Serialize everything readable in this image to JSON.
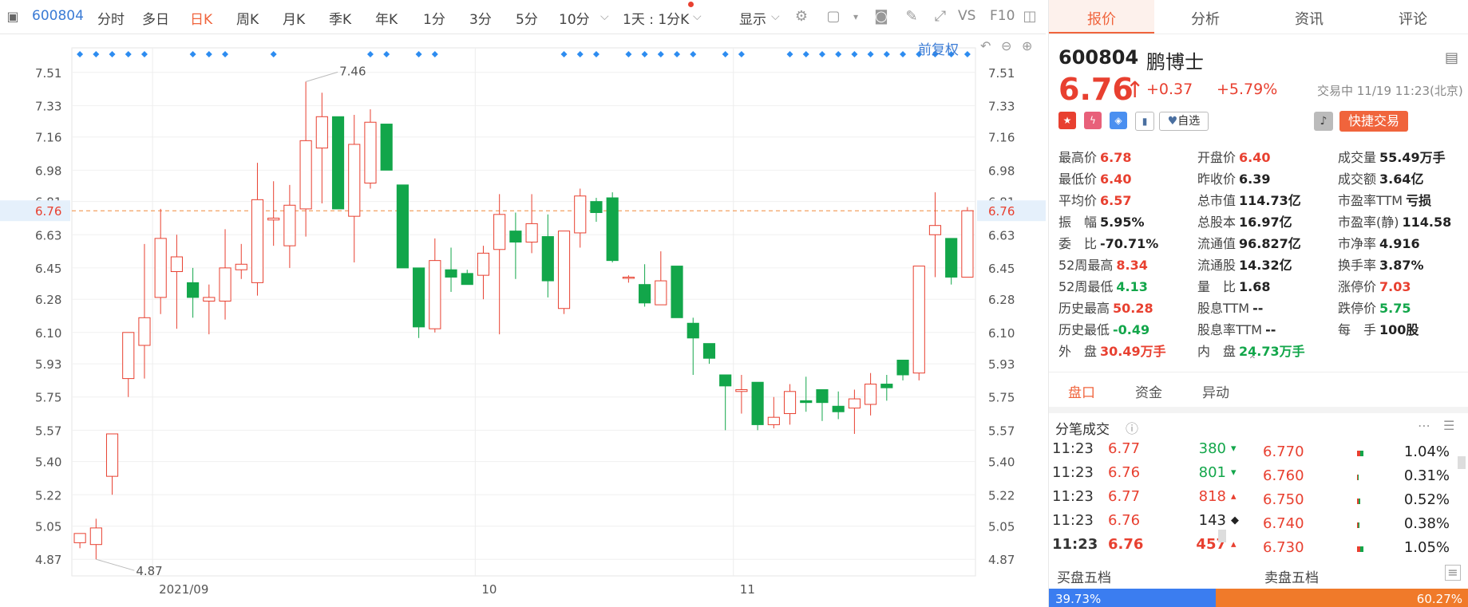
{
  "toolbar": {
    "code": "600804",
    "periods": [
      "分时",
      "多日",
      "日K",
      "周K",
      "月K",
      "季K",
      "年K",
      "1分",
      "3分",
      "5分",
      "10分"
    ],
    "active_period": "日K",
    "interval": "1天 : 1分K",
    "display": "显示",
    "vs": "VS",
    "f10": "F10",
    "adjust": "前复权"
  },
  "chart_data": {
    "type": "candlestick",
    "y_ticks": [
      7.51,
      7.33,
      7.16,
      6.98,
      6.81,
      6.63,
      6.45,
      6.28,
      6.1,
      5.93,
      5.75,
      5.57,
      5.4,
      5.22,
      5.05,
      4.87
    ],
    "ylim": [
      4.78,
      7.6
    ],
    "current_price": 6.76,
    "x_labels": [
      {
        "label": "2021/09",
        "index": 5
      },
      {
        "label": "10",
        "index": 25
      },
      {
        "label": "11",
        "index": 41
      }
    ],
    "high_annotation": {
      "label": "7.46",
      "index": 14
    },
    "low_annotation": {
      "label": "4.87",
      "index": 1
    },
    "candles": [
      {
        "o": 4.96,
        "h": 5.0,
        "l": 4.93,
        "c": 5.01
      },
      {
        "o": 4.95,
        "h": 5.09,
        "l": 4.87,
        "c": 5.04
      },
      {
        "o": 5.32,
        "h": 5.55,
        "l": 5.22,
        "c": 5.55
      },
      {
        "o": 5.85,
        "h": 6.1,
        "l": 5.75,
        "c": 6.1
      },
      {
        "o": 6.03,
        "h": 6.58,
        "l": 5.85,
        "c": 6.18
      },
      {
        "o": 6.29,
        "h": 6.77,
        "l": 6.2,
        "c": 6.61
      },
      {
        "o": 6.43,
        "h": 6.63,
        "l": 6.12,
        "c": 6.51
      },
      {
        "o": 6.37,
        "h": 6.45,
        "l": 6.18,
        "c": 6.29
      },
      {
        "o": 6.27,
        "h": 6.36,
        "l": 6.09,
        "c": 6.29
      },
      {
        "o": 6.27,
        "h": 6.66,
        "l": 6.17,
        "c": 6.45
      },
      {
        "o": 6.44,
        "h": 6.58,
        "l": 6.39,
        "c": 6.47
      },
      {
        "o": 6.37,
        "h": 7.02,
        "l": 6.3,
        "c": 6.82
      },
      {
        "o": 6.71,
        "h": 6.92,
        "l": 6.57,
        "c": 6.72
      },
      {
        "o": 6.57,
        "h": 6.9,
        "l": 6.45,
        "c": 6.79
      },
      {
        "o": 6.77,
        "h": 7.46,
        "l": 6.62,
        "c": 7.14
      },
      {
        "o": 7.1,
        "h": 7.4,
        "l": 6.8,
        "c": 7.27
      },
      {
        "o": 7.27,
        "h": 7.25,
        "l": 6.77,
        "c": 6.77
      },
      {
        "o": 6.73,
        "h": 7.28,
        "l": 6.48,
        "c": 7.12
      },
      {
        "o": 6.91,
        "h": 7.31,
        "l": 6.88,
        "c": 7.24
      },
      {
        "o": 7.23,
        "h": 7.23,
        "l": 6.98,
        "c": 6.98
      },
      {
        "o": 6.9,
        "h": 6.9,
        "l": 6.45,
        "c": 6.45
      },
      {
        "o": 6.45,
        "h": 6.45,
        "l": 6.07,
        "c": 6.13
      },
      {
        "o": 6.12,
        "h": 6.61,
        "l": 6.1,
        "c": 6.49
      },
      {
        "o": 6.44,
        "h": 6.56,
        "l": 6.32,
        "c": 6.4
      },
      {
        "o": 6.42,
        "h": 6.44,
        "l": 6.36,
        "c": 6.36
      },
      {
        "o": 6.41,
        "h": 6.57,
        "l": 6.28,
        "c": 6.53
      },
      {
        "o": 6.55,
        "h": 6.85,
        "l": 6.09,
        "c": 6.74
      },
      {
        "o": 6.65,
        "h": 6.75,
        "l": 6.39,
        "c": 6.59
      },
      {
        "o": 6.59,
        "h": 6.85,
        "l": 6.53,
        "c": 6.69
      },
      {
        "o": 6.62,
        "h": 6.74,
        "l": 6.29,
        "c": 6.38
      },
      {
        "o": 6.23,
        "h": 6.65,
        "l": 6.2,
        "c": 6.65
      },
      {
        "o": 6.64,
        "h": 6.88,
        "l": 6.56,
        "c": 6.84
      },
      {
        "o": 6.81,
        "h": 6.83,
        "l": 6.7,
        "c": 6.75
      },
      {
        "o": 6.83,
        "h": 6.86,
        "l": 6.48,
        "c": 6.49
      },
      {
        "o": 6.4,
        "h": 6.41,
        "l": 6.37,
        "c": 6.4
      },
      {
        "o": 6.36,
        "h": 6.47,
        "l": 6.24,
        "c": 6.26
      },
      {
        "o": 6.25,
        "h": 6.54,
        "l": 6.25,
        "c": 6.38
      },
      {
        "o": 6.46,
        "h": 6.46,
        "l": 6.18,
        "c": 6.18
      },
      {
        "o": 6.15,
        "h": 6.18,
        "l": 5.87,
        "c": 6.07
      },
      {
        "o": 6.04,
        "h": 6.04,
        "l": 5.93,
        "c": 5.96
      },
      {
        "o": 5.87,
        "h": 5.87,
        "l": 5.57,
        "c": 5.81
      },
      {
        "o": 5.78,
        "h": 5.87,
        "l": 5.66,
        "c": 5.79
      },
      {
        "o": 5.83,
        "h": 5.83,
        "l": 5.57,
        "c": 5.6
      },
      {
        "o": 5.6,
        "h": 5.75,
        "l": 5.58,
        "c": 5.64
      },
      {
        "o": 5.66,
        "h": 5.82,
        "l": 5.6,
        "c": 5.78
      },
      {
        "o": 5.73,
        "h": 5.86,
        "l": 5.67,
        "c": 5.72
      },
      {
        "o": 5.79,
        "h": 5.79,
        "l": 5.62,
        "c": 5.72
      },
      {
        "o": 5.7,
        "h": 5.78,
        "l": 5.63,
        "c": 5.67
      },
      {
        "o": 5.69,
        "h": 5.79,
        "l": 5.55,
        "c": 5.74
      },
      {
        "o": 5.71,
        "h": 5.88,
        "l": 5.65,
        "c": 5.82
      },
      {
        "o": 5.82,
        "h": 5.87,
        "l": 5.73,
        "c": 5.8
      },
      {
        "o": 5.95,
        "h": 5.95,
        "l": 5.84,
        "c": 5.87
      },
      {
        "o": 5.88,
        "h": 6.46,
        "l": 5.84,
        "c": 6.46
      },
      {
        "o": 6.63,
        "h": 6.86,
        "l": 6.4,
        "c": 6.68
      },
      {
        "o": 6.61,
        "h": 6.6,
        "l": 6.36,
        "c": 6.4
      },
      {
        "o": 6.4,
        "h": 6.78,
        "l": 6.4,
        "c": 6.76
      }
    ],
    "limit_markers": [
      0,
      1,
      2,
      3,
      4,
      7,
      8,
      9,
      12,
      18,
      19,
      21,
      22,
      30,
      31,
      32,
      34,
      35,
      36,
      37,
      38,
      40,
      41,
      44,
      45,
      46,
      47,
      48,
      49,
      50,
      51,
      52,
      53,
      54,
      55
    ]
  },
  "quote": {
    "tabs": [
      "报价",
      "分析",
      "资讯",
      "评论"
    ],
    "code": "600804",
    "name": "鹏博士",
    "price": "6.76",
    "arrow": "↑",
    "change": "+0.37",
    "change_pct": "+5.79%",
    "trade_status": "交易中 11/19 11:23(北京)",
    "watch": "自选",
    "quick_trade": "快捷交易",
    "stats": [
      {
        "label": "最高价",
        "value": "6.78",
        "color": "red"
      },
      {
        "label": "开盘价",
        "value": "6.40",
        "color": "red"
      },
      {
        "label": "成交量",
        "value": "55.49万手",
        "color": "dark"
      },
      {
        "label": "最低价",
        "value": "6.40",
        "color": "red"
      },
      {
        "label": "昨收价",
        "value": "6.39",
        "color": "dark"
      },
      {
        "label": "成交额",
        "value": "3.64亿",
        "color": "dark"
      },
      {
        "label": "平均价",
        "value": "6.57",
        "color": "red"
      },
      {
        "label": "总市值",
        "value": "114.73亿",
        "color": "dark"
      },
      {
        "label": "市盈率TTM",
        "value": "亏损",
        "color": "dark"
      },
      {
        "label": "振　幅",
        "value": "5.95%",
        "color": "dark"
      },
      {
        "label": "总股本",
        "value": "16.97亿",
        "color": "dark"
      },
      {
        "label": "市盈率(静)",
        "value": "114.58",
        "color": "dark"
      },
      {
        "label": "委　比",
        "value": "-70.71%",
        "color": "dark"
      },
      {
        "label": "流通值",
        "value": "96.827亿",
        "color": "dark"
      },
      {
        "label": "市净率",
        "value": "4.916",
        "color": "dark"
      },
      {
        "label": "52周最高",
        "value": "8.34",
        "color": "red"
      },
      {
        "label": "流通股",
        "value": "14.32亿",
        "color": "dark"
      },
      {
        "label": "换手率",
        "value": "3.87%",
        "color": "dark"
      },
      {
        "label": "52周最低",
        "value": "4.13",
        "color": "green"
      },
      {
        "label": "量　比",
        "value": "1.68",
        "color": "dark"
      },
      {
        "label": "涨停价",
        "value": "7.03",
        "color": "red"
      },
      {
        "label": "历史最高",
        "value": "50.28",
        "color": "red"
      },
      {
        "label": "股息TTM",
        "value": "--",
        "color": "dark"
      },
      {
        "label": "跌停价",
        "value": "5.75",
        "color": "green"
      },
      {
        "label": "历史最低",
        "value": "-0.49",
        "color": "green"
      },
      {
        "label": "股息率TTM",
        "value": "--",
        "color": "dark"
      },
      {
        "label": "每　手",
        "value": "100股",
        "color": "dark"
      },
      {
        "label": "外　盘",
        "value": "30.49万手",
        "color": "red"
      },
      {
        "label": "内　盘",
        "value": "24.73万手",
        "color": "green"
      }
    ],
    "sub_tabs": [
      "盘口",
      "资金",
      "异动"
    ],
    "ticks_title": "分笔成交",
    "ticks": [
      {
        "time": "11:23",
        "price": "6.77",
        "vol": "380",
        "dir": "down"
      },
      {
        "time": "11:23",
        "price": "6.76",
        "vol": "801",
        "dir": "down"
      },
      {
        "time": "11:23",
        "price": "6.77",
        "vol": "818",
        "dir": "up"
      },
      {
        "time": "11:23",
        "price": "6.76",
        "vol": "143",
        "dir": "flat"
      },
      {
        "time": "11:23",
        "price": "6.76",
        "vol": "457",
        "dir": "up"
      }
    ],
    "levels": [
      {
        "price": "6.770",
        "pct": "1.04%",
        "fill": 0.6
      },
      {
        "price": "6.760",
        "pct": "0.31%",
        "fill": 0.15
      },
      {
        "price": "6.750",
        "pct": "0.52%",
        "fill": 0.3
      },
      {
        "price": "6.740",
        "pct": "0.38%",
        "fill": 0.2
      },
      {
        "price": "6.730",
        "pct": "1.05%",
        "fill": 0.6
      }
    ],
    "buy_label": "买盘五档",
    "sell_label": "卖盘五档",
    "buy_pct": "39.73%",
    "sell_pct": "60.27%",
    "buy_ratio": 0.3973
  }
}
